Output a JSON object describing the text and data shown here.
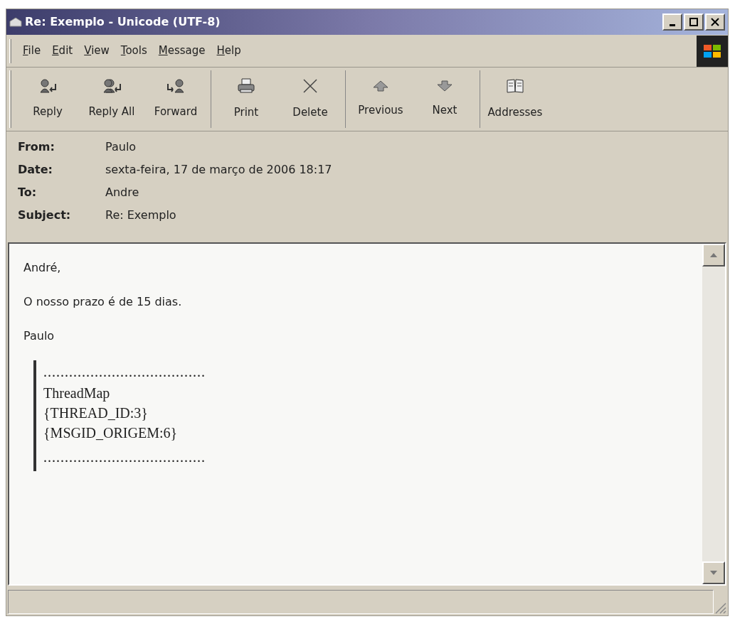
{
  "window": {
    "title": "Re: Exemplo - Unicode (UTF-8)"
  },
  "menu": [
    "File",
    "Edit",
    "View",
    "Tools",
    "Message",
    "Help"
  ],
  "toolbar": [
    [
      "Reply",
      "Reply All",
      "Forward"
    ],
    [
      "Print",
      "Delete"
    ],
    [
      "Previous",
      "Next"
    ],
    [
      "Addresses"
    ]
  ],
  "header": [
    {
      "label": "From:",
      "value": "Paulo"
    },
    {
      "label": "Date:",
      "value": "sexta-feira, 17 de março de 2006 18:17"
    },
    {
      "label": "To:",
      "value": "Andre"
    },
    {
      "label": "Subject:",
      "value": "Re: Exemplo"
    }
  ],
  "body": {
    "paragraphs": [
      "André,",
      "O nosso prazo é de 15 dias.",
      "Paulo"
    ],
    "quote": {
      "top_rule": "......................................",
      "lines": [
        "ThreadMap",
        "{THREAD_ID:3}",
        "{MSGID_ORIGEM:6}"
      ],
      "bottom_rule": "......................................"
    }
  }
}
